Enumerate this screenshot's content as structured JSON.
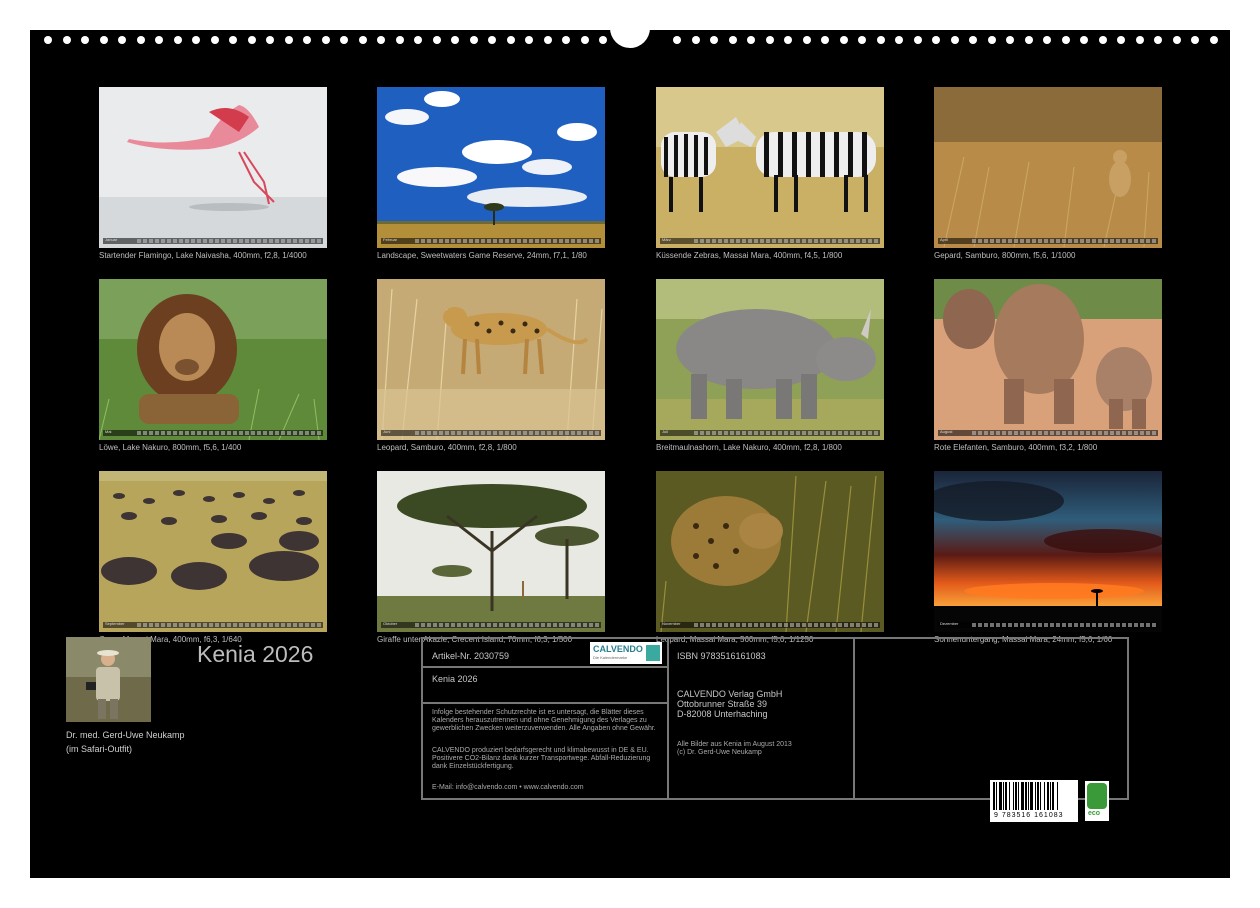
{
  "calendar": {
    "title": "Kenia 2026",
    "photos": [
      {
        "month": "Januar",
        "caption": "Startender Flamingo, Lake Naivasha, 400mm, f2,8, 1/4000"
      },
      {
        "month": "Februar",
        "caption": "Landscape, Sweetwaters Game Reserve, 24mm, f7,1, 1/80"
      },
      {
        "month": "März",
        "caption": "Küssende Zebras, Massai Mara, 400mm, f4,5, 1/800"
      },
      {
        "month": "April",
        "caption": "Gepard, Samburo, 800mm, f5,6, 1/1000"
      },
      {
        "month": "Mai",
        "caption": "Löwe, Lake Nakuro, 800mm, f5,6, 1/400"
      },
      {
        "month": "Juni",
        "caption": "Leopard, Samburo, 400mm, f2,8, 1/800"
      },
      {
        "month": "Juli",
        "caption": "Breitmaulnashorn, Lake Nakuro, 400mm, f2,8, 1/800"
      },
      {
        "month": "August",
        "caption": "Rote Elefanten, Samburo, 400mm, f3,2, 1/800"
      },
      {
        "month": "September",
        "caption": "Gnus, Massai Mara, 400mm, f6,3, 1/640"
      },
      {
        "month": "Oktober",
        "caption": "Giraffe unter Akazie, Crecent Island, 70mm, f6,3, 1/500"
      },
      {
        "month": "November",
        "caption": "Leopard, Massai Mara, 560mm, f5,0, 1/1250"
      },
      {
        "month": "Dezember",
        "caption": "Sonnenuntergang, Massai Mara, 24mm, f5,6, 1/60"
      }
    ],
    "author_lines": [
      "Dr. med. Gerd-Uwe Neukamp",
      "(im Safari-Outfit)"
    ]
  },
  "info_box": {
    "article_no": "Artikel-Nr. 2030759",
    "logo_text": "CALVENDO",
    "logo_tagline": "Die Kalendermarke",
    "title": "Kenia 2026",
    "legal_1": "Infolge bestehender Schutzrechte ist es untersagt, die Blätter dieses Kalenders herauszutrennen und ohne Genehmigung des Verlages zu gewerblichen Zwecken weiterzuverwenden. Alle Angaben ohne Gewähr.",
    "legal_2": "CALVENDO produziert bedarfsgerecht und klimabewusst in DE & EU. Positivere CO2-Bilanz dank kurzer Transportwege. Abfall-Reduzierung dank Einzelstückfertigung.",
    "contact": "E-Mail: info@calvendo.com • www.calvendo.com",
    "isbn": "ISBN 9783516161083",
    "publisher_lines": [
      "CALVENDO Verlag GmbH",
      "Ottobrunner Straße 39",
      "D-82008 Unterhaching"
    ],
    "credits_lines": [
      "Alle Bilder aus Kenia im August 2013",
      "(c) Dr. Gerd-Uwe Neukamp"
    ],
    "barcode_number": "9 783516 161083",
    "eco_label": "eco"
  }
}
